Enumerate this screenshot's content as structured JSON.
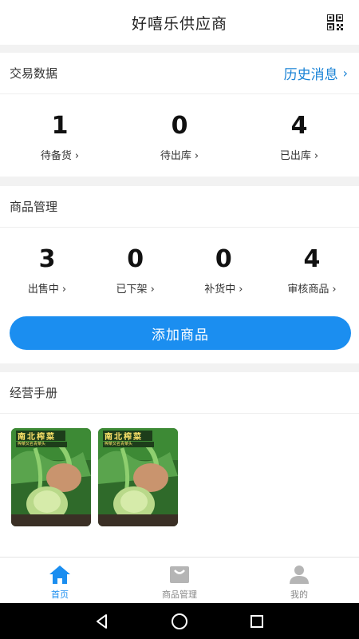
{
  "app": {
    "title": "好嘻乐供应商"
  },
  "header": {
    "qr_icon": "qr-code-icon"
  },
  "trade": {
    "title": "交易数据",
    "history_link": "历史消息",
    "stats": [
      {
        "value": "1",
        "label": "待备货"
      },
      {
        "value": "0",
        "label": "待出库"
      },
      {
        "value": "4",
        "label": "已出库"
      }
    ]
  },
  "goods": {
    "title": "商品管理",
    "stats": [
      {
        "value": "3",
        "label": "出售中"
      },
      {
        "value": "0",
        "label": "已下架"
      },
      {
        "value": "0",
        "label": "补货中"
      },
      {
        "value": "4",
        "label": "审核商品"
      }
    ],
    "add_button": "添加商品"
  },
  "manual": {
    "title": "经营手册",
    "items": [
      {
        "caption": "南北榨菜",
        "subcaption": "榨菜又名青菜头"
      },
      {
        "caption": "南北榨菜",
        "subcaption": "榨菜又名青菜头"
      }
    ]
  },
  "tabbar": {
    "items": [
      {
        "label": "首页",
        "icon": "home-icon",
        "active": true
      },
      {
        "label": "商品管理",
        "icon": "bag-icon",
        "active": false
      },
      {
        "label": "我的",
        "icon": "user-icon",
        "active": false
      }
    ],
    "active_color": "#1b8ef0",
    "inactive_color": "#b5b5b5"
  },
  "system_nav": {
    "icons": [
      "back-icon",
      "home-circle-icon",
      "recents-icon"
    ]
  },
  "colors": {
    "accent": "#1b8ef0",
    "link": "#1a83d6"
  }
}
